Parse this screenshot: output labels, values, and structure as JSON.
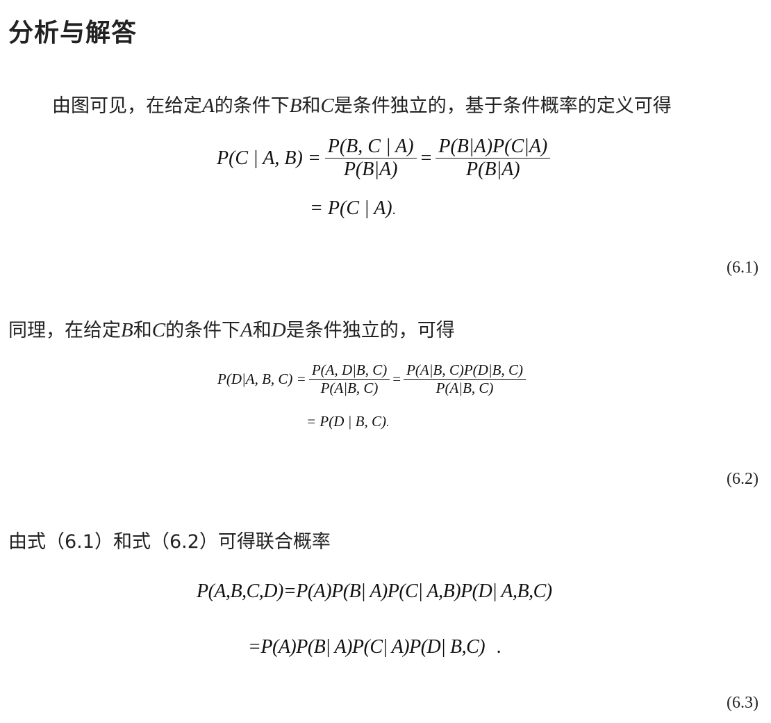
{
  "heading": "分析与解答",
  "para1": {
    "t1": "由图可见，在给定",
    "v1": "A",
    "t2": "的条件下",
    "v2": "B",
    "t3": "和",
    "v3": "C",
    "t4": "是条件独立的，基于条件概率的定义可得"
  },
  "eq1": {
    "lhs": "P(C | A, B) =",
    "frac1_num": "P(B, C | A)",
    "frac1_den": "P(B|A)",
    "eq": "=",
    "frac2_num": "P(B|A)P(C|A)",
    "frac2_den": "P(B|A)",
    "line2": "= P(C | A)",
    "dot": ".",
    "number": "(6.1)"
  },
  "para2": {
    "t1": "同理，在给定",
    "v1": "B",
    "t2": "和",
    "v2": "C",
    "t3": "的条件下",
    "v3": "A",
    "t4": "和",
    "v4": "D",
    "t5": "是条件独立的，可得"
  },
  "eq2": {
    "lhs": "P(D|A, B, C) =",
    "frac1_num": "P(A, D|B, C)",
    "frac1_den": "P(A|B, C)",
    "eq": "=",
    "frac2_num": "P(A|B, C)P(D|B, C)",
    "frac2_den": "P(A|B, C)",
    "line2": "= P(D | B, C)",
    "dot": ".",
    "number": "(6.2)"
  },
  "para3": {
    "text": "由式（6.1）和式（6.2）可得联合概率"
  },
  "eq3": {
    "line1": "P(A,B,C,D)=P(A)P(B| A)P(C| A,B)P(D| A,B,C)",
    "line2": "=P(A)P(B| A)P(C| A)P(D| B,C)",
    "dot": ".",
    "number": "(6.3)"
  }
}
